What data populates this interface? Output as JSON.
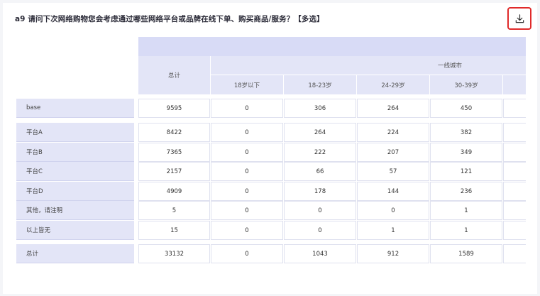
{
  "title": "a9 请问下次网络购物您会考虑通过哪些网络平台或品牌在线下单、购买商品/服务？【多选】",
  "download_icon": "download-icon",
  "colors": {
    "accent_border": "#e02a2a",
    "header_band": "#d8dbf6",
    "header_cell": "#e3e5f7"
  },
  "table": {
    "total_header": "总计",
    "group_header": "一线城市",
    "age_headers": [
      "18岁以下",
      "18-23岁",
      "24-29岁",
      "30-39岁"
    ],
    "base_row": {
      "label": "base",
      "values": [
        "9595",
        "0",
        "306",
        "264",
        "450"
      ]
    },
    "rows": [
      {
        "label": "平台A",
        "values": [
          "8422",
          "0",
          "264",
          "224",
          "382"
        ]
      },
      {
        "label": "平台B",
        "values": [
          "7365",
          "0",
          "222",
          "207",
          "349"
        ]
      },
      {
        "label": "平台C",
        "values": [
          "2157",
          "0",
          "66",
          "57",
          "121"
        ]
      },
      {
        "label": "平台D",
        "values": [
          "4909",
          "0",
          "178",
          "144",
          "236"
        ]
      },
      {
        "label": "其他，请注明",
        "values": [
          "5",
          "0",
          "0",
          "0",
          "1"
        ]
      },
      {
        "label": "以上皆无",
        "values": [
          "15",
          "0",
          "0",
          "1",
          "1"
        ]
      }
    ],
    "total_row": {
      "label": "总计",
      "values": [
        "33132",
        "0",
        "1043",
        "912",
        "1589"
      ]
    }
  }
}
